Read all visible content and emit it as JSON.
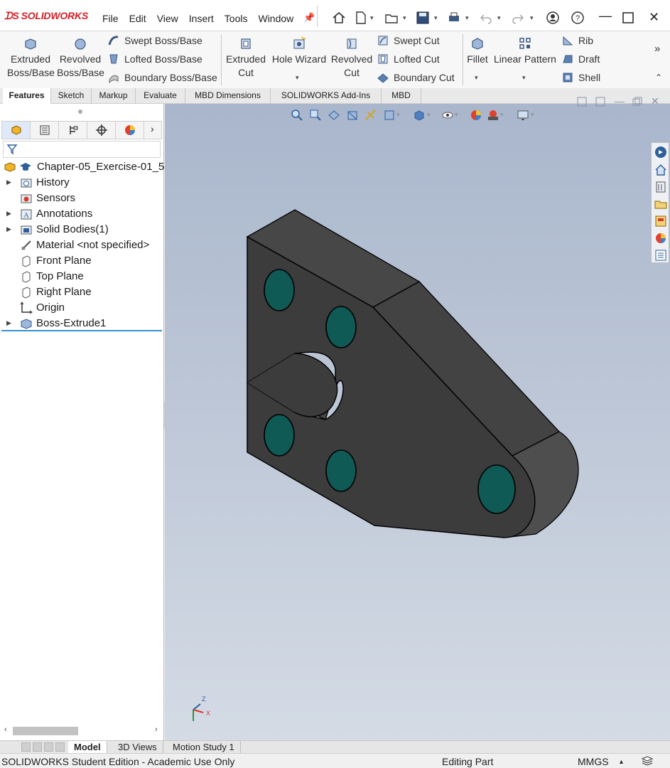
{
  "app": {
    "logo_text": "SOLIDWORKS",
    "menu": [
      "File",
      "Edit",
      "View",
      "Insert",
      "Tools",
      "Window"
    ]
  },
  "ribbon": {
    "extruded_boss": [
      "Extruded",
      "Boss/Base"
    ],
    "revolved_boss": [
      "Revolved",
      "Boss/Base"
    ],
    "swept_boss": "Swept Boss/Base",
    "lofted_boss": "Lofted Boss/Base",
    "boundary_boss": "Boundary Boss/Base",
    "extruded_cut": [
      "Extruded",
      "Cut"
    ],
    "hole_wizard": "Hole Wizard",
    "revolved_cut": [
      "Revolved",
      "Cut"
    ],
    "swept_cut": "Swept Cut",
    "lofted_cut": "Lofted Cut",
    "boundary_cut": "Boundary Cut",
    "fillet": "Fillet",
    "linear_pattern": "Linear Pattern",
    "rib": "Rib",
    "draft": "Draft",
    "shell": "Shell"
  },
  "tabs": [
    "Features",
    "Sketch",
    "Markup",
    "Evaluate",
    "MBD Dimensions",
    "SOLIDWORKS Add-Ins",
    "MBD"
  ],
  "tree": {
    "root": "Chapter-05_Exercise-01_5-",
    "items": [
      "History",
      "Sensors",
      "Annotations",
      "Solid Bodies(1)",
      "Material <not specified>",
      "Front Plane",
      "Top Plane",
      "Right Plane",
      "Origin",
      "Boss-Extrude1"
    ]
  },
  "triad": {
    "z": "Z",
    "x": "X"
  },
  "bottom_tabs": [
    "Model",
    "3D Views",
    "Motion Study 1"
  ],
  "status": {
    "edition": "SOLIDWORKS Student Edition - Academic Use Only",
    "mode": "Editing Part",
    "units": "MMGS"
  },
  "colors": {
    "brand": "#d32027",
    "model_face": "#3c3c3c",
    "model_top": "#4a4a4a",
    "hole": "#0f5a55",
    "selection": "#3a8fd0"
  }
}
